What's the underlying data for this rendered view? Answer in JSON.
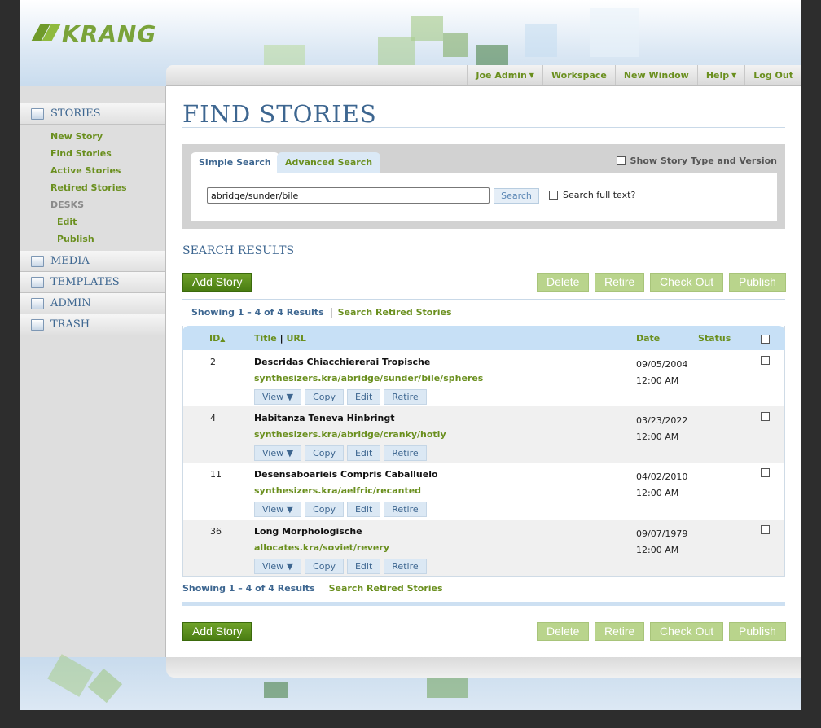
{
  "app": {
    "logo_text": "KRANG"
  },
  "topnav": [
    {
      "label": "Joe Admin",
      "dropdown": true
    },
    {
      "label": "Workspace",
      "dropdown": false
    },
    {
      "label": "New Window",
      "dropdown": false
    },
    {
      "label": "Help",
      "dropdown": true
    },
    {
      "label": "Log Out",
      "dropdown": false
    }
  ],
  "sidebar": {
    "stories": {
      "label": "STORIES",
      "items": [
        "New Story",
        "Find Stories",
        "Active Stories",
        "Retired Stories"
      ],
      "desks_label": "DESKS",
      "desk_items": [
        "Edit",
        "Publish"
      ]
    },
    "sections": [
      "MEDIA",
      "TEMPLATES",
      "ADMIN",
      "TRASH"
    ]
  },
  "page": {
    "title": "FIND STORIES"
  },
  "search": {
    "tab_simple": "Simple Search",
    "tab_advanced": "Advanced Search",
    "show_type_label": "Show Story Type and Version",
    "query": "abridge/sunder/bile",
    "search_button": "Search",
    "full_text_label": "Search full text?"
  },
  "results": {
    "heading": "SEARCH RESULTS",
    "add_story": "Add Story",
    "actions": [
      "Delete",
      "Retire",
      "Check Out",
      "Publish"
    ],
    "showing": "Showing 1 – 4 of 4 Results",
    "retired_link": "Search Retired Stories",
    "columns": {
      "id": "ID",
      "title": "Title",
      "url": "URL",
      "date": "Date",
      "status": "Status"
    },
    "row_actions": [
      "View ▼",
      "Copy",
      "Edit",
      "Retire"
    ],
    "rows": [
      {
        "id": "2",
        "title": "Descridas Chiacchiererai Tropische",
        "url": "synthesizers.kra/abridge/sunder/bile/spheres",
        "date": "09/05/2004",
        "time": "12:00 AM"
      },
      {
        "id": "4",
        "title": "Habitanza Teneva Hinbringt",
        "url": "synthesizers.kra/abridge/cranky/hotly",
        "date": "03/23/2022",
        "time": "12:00 AM"
      },
      {
        "id": "11",
        "title": "Desensaboarieis Compris Caballuelo",
        "url": "synthesizers.kra/aelfric/recanted",
        "date": "04/02/2010",
        "time": "12:00 AM"
      },
      {
        "id": "36",
        "title": "Long Morphologische",
        "url": "allocates.kra/soviet/revery",
        "date": "09/07/1979",
        "time": "12:00 AM"
      }
    ]
  },
  "colors": {
    "accent_green": "#6a8f1e",
    "heading_blue": "#3d6690",
    "button_green": "#5a8f1c"
  }
}
